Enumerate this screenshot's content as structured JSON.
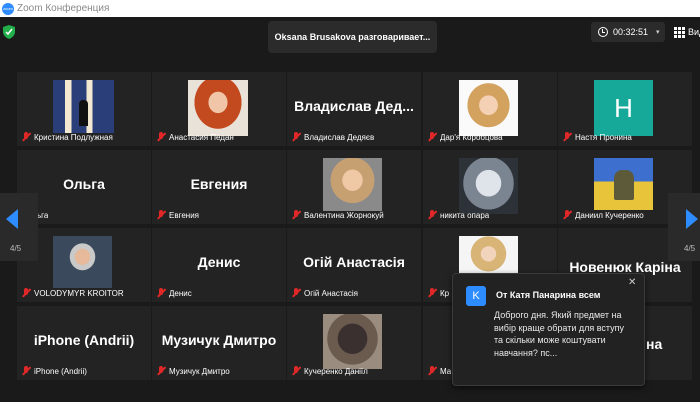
{
  "window": {
    "title": "Zoom Конференция",
    "logo_text": "zoom"
  },
  "header": {
    "speaker": "Oksana Brusakova разговаривает...",
    "timer": "00:32:51",
    "view_label": "Вид"
  },
  "participants": [
    {
      "label": "Кристина Подлужная"
    },
    {
      "label": "Анастасия Педан"
    },
    {
      "label": "Владислав Дедяєв",
      "big": "Владислав Дед..."
    },
    {
      "label": "Дар'я Коробцова"
    },
    {
      "label": "Настя Пронина",
      "letter": "H"
    },
    {
      "label": "ьга",
      "big": "Ольга"
    },
    {
      "label": "Евгения",
      "big": "Евгения"
    },
    {
      "label": "Валентина Жорнокуй"
    },
    {
      "label": "никита опара"
    },
    {
      "label": "Даниил Кучеренко"
    },
    {
      "label": "VOLODYMYR KROITOR"
    },
    {
      "label": "Денис",
      "big": "Денис"
    },
    {
      "label": "Огій Анастасія",
      "big": "Огій Анастасія"
    },
    {
      "label": "Кр"
    },
    {
      "label": "",
      "big": "Новенюк Каріна"
    },
    {
      "label": "iPhone (Andrii)",
      "big": "iPhone (Andrii)"
    },
    {
      "label": "Музичук Дмитро",
      "big": "Музичук Дмитро"
    },
    {
      "label": "Кучеренко Даніїл"
    },
    {
      "label": "Ма"
    },
    {
      "label": "",
      "big": "на"
    }
  ],
  "pagination": {
    "left": "4/5",
    "right": "4/5"
  },
  "chat": {
    "avatar_letter": "K",
    "from": "От Катя Панарина всем",
    "message": "Доброго дня. Який предмет на вибір краще обрати для вступу та скільки може коштувати навчання? пс...",
    "close": "✕"
  },
  "colors": {
    "accent": "#2d8cff",
    "muted_mic": "#e02828",
    "tile_bg": "#232323"
  }
}
